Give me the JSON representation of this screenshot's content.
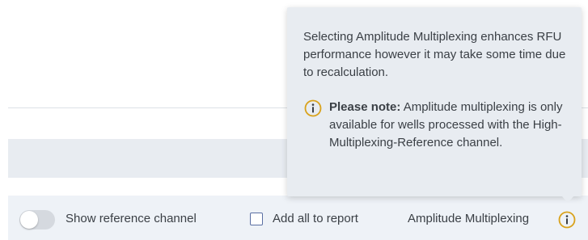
{
  "toolbar": {
    "show_reference_label": "Show reference channel",
    "show_reference_on": false,
    "add_all_label": "Add all to report",
    "add_all_checked": false,
    "amplitude_label": "Amplitude Multiplexing",
    "info_icon": "info-circle-icon"
  },
  "tooltip": {
    "main_text": "Selecting Amplitude Multiplexing enhances RFU performance however it may take some time due to recalculation.",
    "note_bold": "Please note:",
    "note_text": " Amplitude multiplexing is only available for wells processed with the High-Multiplexing-Reference channel.",
    "note_icon": "info-circle-icon"
  },
  "colors": {
    "accent_orange": "#d9a21b",
    "tooltip_bg": "#e8ecf1",
    "toolbar_bg": "#eef2f7",
    "checkbox_border": "#5a6fa3"
  }
}
